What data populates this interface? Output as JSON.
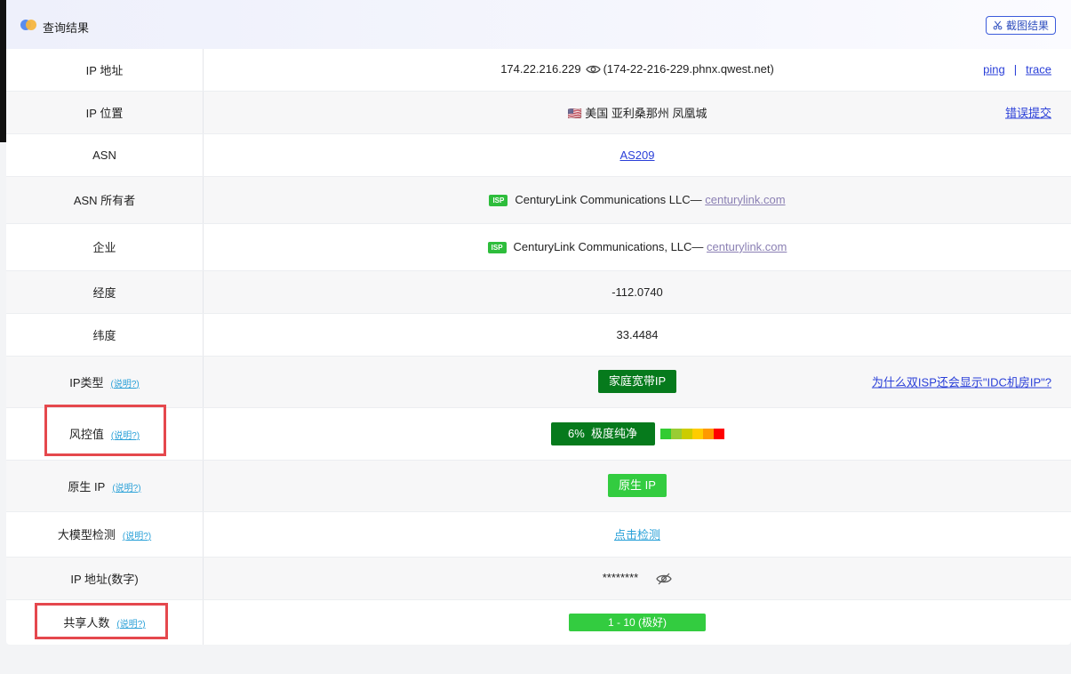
{
  "header": {
    "title": "查询结果",
    "screenshot_label": "截图结果"
  },
  "help_label": "(说明?)",
  "rows": {
    "ip": {
      "label": "IP 地址",
      "address": "174.22.216.229",
      "hostname": "(174-22-216-229.phnx.qwest.net)",
      "link_ping": "ping",
      "separator": "|",
      "link_trace": "trace"
    },
    "location": {
      "label": "IP 位置",
      "flag": "🇺🇸",
      "value": "美国 亚利桑那州 凤凰城",
      "report_link": "错误提交"
    },
    "asn": {
      "label": "ASN",
      "value": "AS209"
    },
    "asn_owner": {
      "label": "ASN 所有者",
      "badge": "ISP",
      "value": "CenturyLink Communications LLC—",
      "domain": "centurylink.com"
    },
    "company": {
      "label": "企业",
      "badge": "ISP",
      "value": "CenturyLink Communications, LLC—",
      "domain": "centurylink.com"
    },
    "longitude": {
      "label": "经度",
      "value": "-112.0740"
    },
    "latitude": {
      "label": "纬度",
      "value": "33.4484"
    },
    "ip_type": {
      "label": "IP类型",
      "value": "家庭宽带IP",
      "why_link": "为什么双ISP还会显示\"IDC机房IP\"?"
    },
    "risk": {
      "label": "风控值",
      "value": "6%  极度纯净",
      "percent": 6,
      "scale_colors": [
        "#33cc33",
        "#99cc33",
        "#cccc00",
        "#ffcc00",
        "#ff9900",
        "#ff0000"
      ]
    },
    "native_ip": {
      "label": "原生 IP",
      "value": "原生 IP"
    },
    "llm": {
      "label": "大模型检测",
      "value": "点击检测"
    },
    "ip_numeric": {
      "label": "IP 地址(数字)",
      "value": "********"
    },
    "shared": {
      "label": "共享人数",
      "value": "1 - 10 (极好)"
    }
  },
  "colors": {
    "highlight_border": "#e5484d",
    "dark_green": "#067a1c",
    "light_green": "#33cc40",
    "link_blue": "#2a3fd8"
  }
}
